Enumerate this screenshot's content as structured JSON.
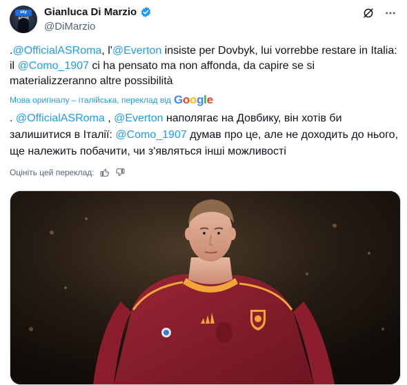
{
  "author": {
    "name": "Gianluca Di Marzio",
    "handle": "@DiMarzio",
    "avatar_badge": "sky sport"
  },
  "icons": {
    "verified": "verified-badge-icon",
    "grok": "grok-icon",
    "more": "more-icon"
  },
  "original_text": {
    "p1": ".",
    "m1": "@OfficialASRoma",
    "p2": ", l'",
    "m2": "@Everton",
    "p3": " insiste per Dovbyk, lui vorrebbe restare in Italia: il ",
    "m3": "@Como_1907",
    "p4": " ci ha pensato ma non affonda, da capire se si materializzeranno altre possibilità"
  },
  "translation_note": "Мова оригіналу – італійська, переклад від",
  "translation_brand": "Google",
  "translated_text": {
    "p1": ". ",
    "m1": "@OfficialASRoma",
    "p2": " , ",
    "m2": "@Everton",
    "p3": " наполягає на Довбику, він хотів би залишитися в Італії: ",
    "m3": "@Como_1907",
    "p4": " думав про це, але не доходить до нього, ще належить побачити, чи з'являться інші можливості"
  },
  "rate_label": "Оцініть цей переклад:",
  "colors": {
    "link": "#1d9bf0",
    "kit": "#8b1d2c",
    "background": "#ffffff"
  }
}
